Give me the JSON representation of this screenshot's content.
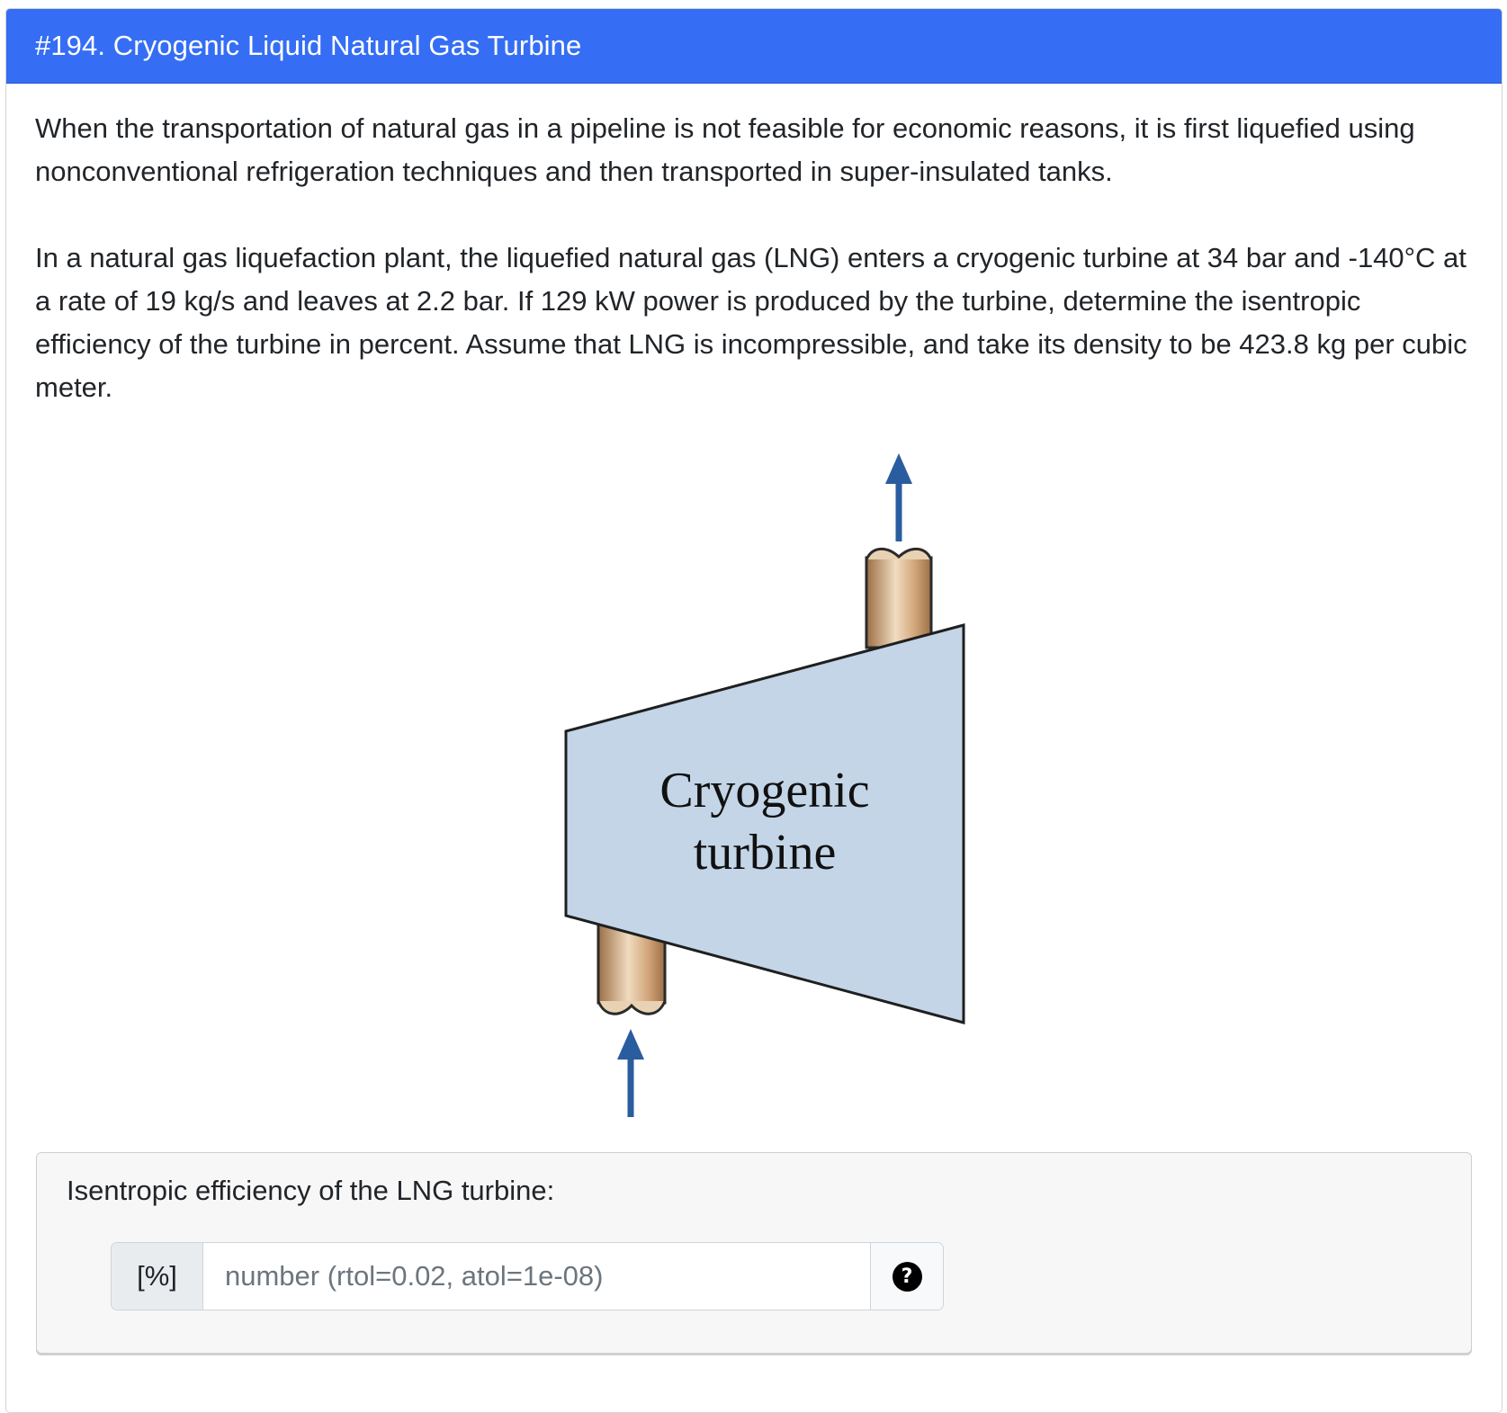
{
  "question": {
    "title": "#194. Cryogenic Liquid Natural Gas Turbine",
    "paragraphs": [
      "When the transportation of natural gas in a pipeline is not feasible for economic reasons, it is first liquefied using nonconventional refrigeration techniques and then transported in super-insulated tanks.",
      "In a natural gas liquefaction plant, the liquefied natural gas (LNG) enters a cryogenic turbine at 34 bar and -140°C at a rate of 19 kg/s and leaves at 2.2 bar. If 129 kW power is produced by the turbine, determine the isentropic efficiency of the turbine in percent. Assume that LNG is incompressible, and take its density to be 423.8 kg per cubic meter."
    ]
  },
  "figure": {
    "label_line1": "Cryogenic",
    "label_line2": "turbine",
    "colors": {
      "turbine_fill": "#c3d5e7",
      "outline": "#1f1f1f",
      "arrow": "#2a5d9f",
      "pipe_light": "#f0dcc0",
      "pipe_dark": "#9c6e45"
    },
    "icons": [
      "arrow-up-icon",
      "arrow-up-icon"
    ]
  },
  "answer": {
    "prompt": "Isentropic efficiency of the LNG turbine:",
    "unit": "[%]",
    "placeholder": "number (rtol=0.02, atol=1e-08)",
    "value": "",
    "help_icon": "?"
  },
  "theme": {
    "header_bg": "#356ef4",
    "header_text": "#ffffff",
    "panel_bg": "#f7f7f7"
  }
}
